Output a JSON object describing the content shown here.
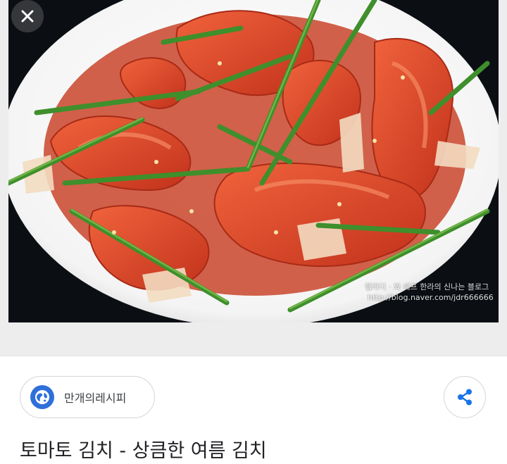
{
  "viewer": {
    "close_icon": "close-icon",
    "image_alt": "토마토 김치",
    "watermark_line1": "랩라더 · 와 쉐프 한라의 신나는 블로그",
    "watermark_line2": "http://blog.naver.com/jdr666666"
  },
  "source": {
    "icon": "globe-icon",
    "name": "만개의레시피"
  },
  "share": {
    "icon": "share-icon"
  },
  "result": {
    "title": "토마토 김치 - 상큼한 여름 김치"
  },
  "colors": {
    "accent": "#1a73e8",
    "globe": "#2f6fd9",
    "title": "#202124"
  }
}
